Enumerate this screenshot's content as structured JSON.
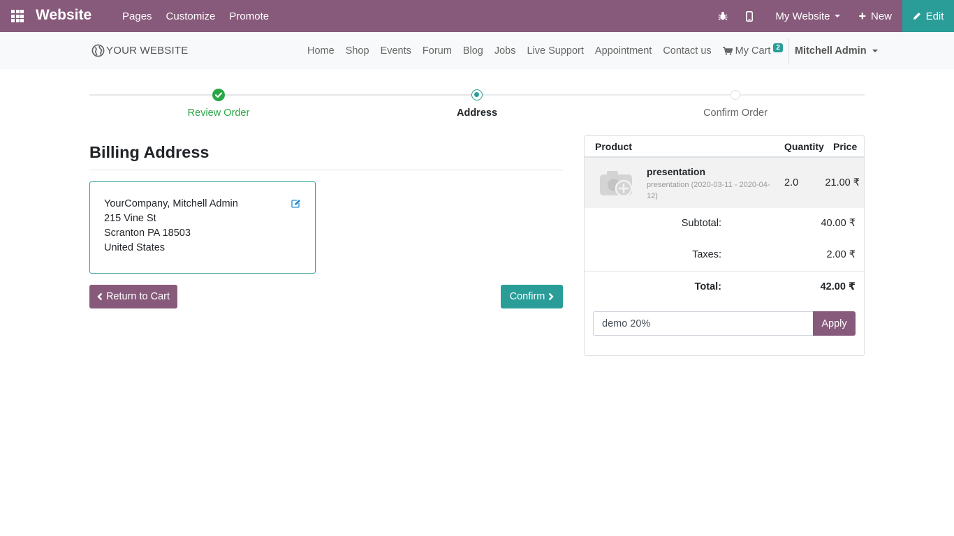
{
  "topbar": {
    "brand": "Website",
    "menu": [
      "Pages",
      "Customize",
      "Promote"
    ],
    "my_website": "My Website",
    "new_label": "New",
    "edit_label": "Edit",
    "icons": [
      "apps-icon",
      "bug-icon",
      "mobile-icon",
      "plus-icon",
      "pencil-icon"
    ],
    "colors": {
      "brand": "#875a7b",
      "accent": "#2a9d98"
    }
  },
  "navbar": {
    "logo_text": "YOUR WEBSITE",
    "items": [
      "Home",
      "Shop",
      "Events",
      "Forum",
      "Blog",
      "Jobs",
      "Live Support",
      "Appointment",
      "Contact us"
    ],
    "cart_label": "My Cart",
    "cart_count": "2",
    "user": "Mitchell Admin"
  },
  "wizard": {
    "steps": [
      {
        "label": "Review Order",
        "state": "done"
      },
      {
        "label": "Address",
        "state": "current"
      },
      {
        "label": "Confirm Order",
        "state": "todo"
      }
    ]
  },
  "billing": {
    "title": "Billing Address",
    "address_lines": [
      "YourCompany, Mitchell Admin",
      "215 Vine St",
      "Scranton PA 18503",
      "United States"
    ],
    "return_label": "Return to Cart",
    "confirm_label": "Confirm"
  },
  "summary": {
    "headers": {
      "product": "Product",
      "quantity": "Quantity",
      "price": "Price"
    },
    "product": {
      "name": "presentation",
      "description": "presentation (2020-03-11 - 2020-04-12)",
      "quantity": "2.0",
      "price": "21.00 ₹"
    },
    "subtotal_label": "Subtotal:",
    "subtotal": "40.00 ₹",
    "taxes_label": "Taxes:",
    "taxes": "2.00 ₹",
    "total_label": "Total:",
    "total": "42.00 ₹",
    "promo_value": "demo 20%",
    "apply_label": "Apply"
  }
}
